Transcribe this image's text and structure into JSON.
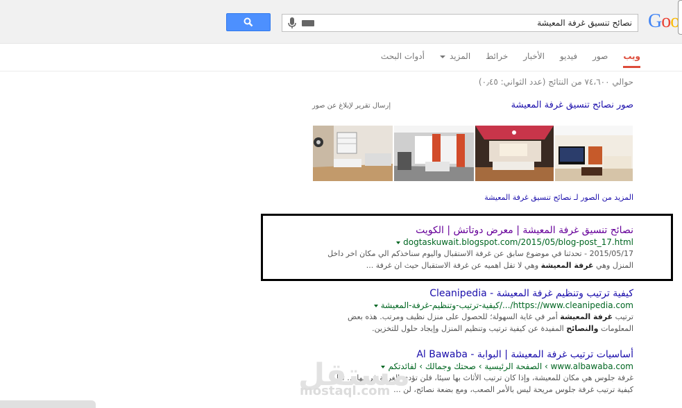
{
  "search": {
    "query": "نصائح تنسيق غرفة المعيشة"
  },
  "logo": {
    "letters": [
      "G",
      "o",
      "o"
    ],
    "colors": [
      "#4285f4",
      "#ea4335",
      "#fbbc05"
    ]
  },
  "tabs": [
    {
      "label": "ويب",
      "active": true
    },
    {
      "label": "صور"
    },
    {
      "label": "فيديو"
    },
    {
      "label": "الأخبار"
    },
    {
      "label": "خرائط"
    },
    {
      "label": "المزيد"
    },
    {
      "label": "أدوات البحث"
    }
  ],
  "stats": "حوالي ٧٤،٦٠٠ من النتائج (عدد الثواني: ٠٫٤٥)",
  "images": {
    "header": "صور نصائح تنسيق غرفة المعيشة",
    "report": "إرسال تقرير لإبلاغ عن صور",
    "more": "المزيد من الصور لـ نصائح تنسيق غرفة المعيشة"
  },
  "results": [
    {
      "title": "نصائح تنسيق غرفة المعيشة | معرض دوتاتش | الكويت",
      "url": "dogtaskuwait.blogspot.com/2015/05/blog-post_17.html",
      "snippet_1": "2015/05/17 - تحدثنا في موضوع سابق عن غرفة الاستقبال واليوم سناخذكم الي مكان اخر داخل",
      "snippet_2_pre": "المنزل وهي ",
      "snippet_2_bold": "غرفة المعيشة",
      "snippet_2_post": " وهي لا تقل اهميه عن غرفة الاستقبال حيث ان غرفة ..."
    },
    {
      "title": "كيفية ترتيب وتنظيم غرفة المعيشة - Cleanipedia",
      "url": "https://www.cleanipedia.com/.../كيفية-ترتيب-وتنظيم-غرفة-المعيشة",
      "snippet_1_pre": "ترتيب ",
      "snippet_1_bold": "غرفة المعيشة",
      "snippet_1_post": " أمر في غاية السهولة؛ للحصول على منزل نظيف ومرتب. هذه بعض",
      "snippet_2_pre": "المعلومات ",
      "snippet_2_bold": "والنصائح",
      "snippet_2_post": " المفيدة عن كيفية ترتيب وتنظيم المنزل وإيجاد حلول للتخزين."
    },
    {
      "title": "أساسيات ترتيب غرفة المعيشة | البوابة - Al Bawaba",
      "url": "www.albawaba.com › الصفحة الرئيسية › صحتك وجمالك › لفائدتكم",
      "snippet_1": "غرفة جلوس هي مكان للمعيشة، وإذا كان ترتيب الأثاث بها سيئا، فلن تؤدي الغرفة غرضها ... تعلم",
      "snippet_2": "كيفية ترتيب غرفة جلوس مريحة ليس بالأمر الصعب، ومع بضعة نصائح، لن ..."
    }
  ],
  "watermark": {
    "text": "مستقل",
    "sub": "mostaql.com"
  }
}
